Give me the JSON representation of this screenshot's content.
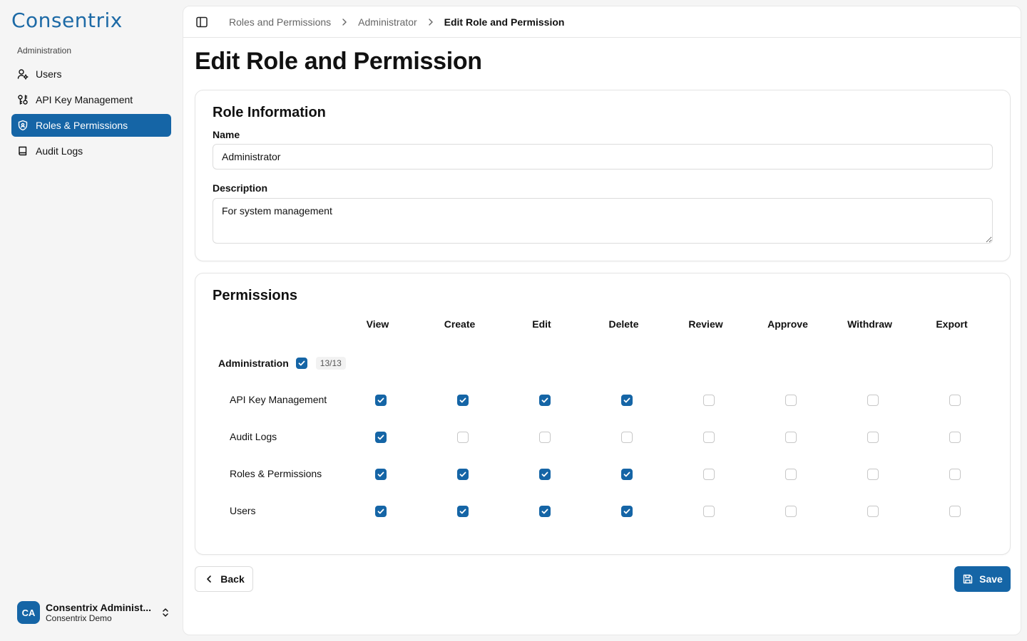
{
  "brand": {
    "logo_text": "Consentrix",
    "accent": "#1565a6"
  },
  "sidebar": {
    "section_label": "Administration",
    "items": [
      {
        "label": "Users",
        "icon": "user-cog-icon",
        "active": false
      },
      {
        "label": "API Key Management",
        "icon": "key-icon",
        "active": false
      },
      {
        "label": "Roles & Permissions",
        "icon": "shield-icon",
        "active": true
      },
      {
        "label": "Audit Logs",
        "icon": "book-icon",
        "active": false
      }
    ],
    "user": {
      "initials": "CA",
      "name": "Consentrix Administ...",
      "org": "Consentrix Demo"
    }
  },
  "breadcrumb": [
    "Roles and Permissions",
    "Administrator",
    "Edit Role and Permission"
  ],
  "page_title": "Edit Role and Permission",
  "role_info": {
    "title": "Role Information",
    "name_label": "Name",
    "name_value": "Administrator",
    "description_label": "Description",
    "description_value": "For system management"
  },
  "permissions": {
    "title": "Permissions",
    "columns": [
      "View",
      "Create",
      "Edit",
      "Delete",
      "Review",
      "Approve",
      "Withdraw",
      "Export"
    ],
    "group": {
      "label": "Administration",
      "checked": true,
      "count": "13/13"
    },
    "rows": [
      {
        "label": "API Key Management",
        "values": [
          true,
          true,
          true,
          true,
          false,
          false,
          false,
          false
        ]
      },
      {
        "label": "Audit Logs",
        "values": [
          true,
          false,
          false,
          false,
          false,
          false,
          false,
          false
        ]
      },
      {
        "label": "Roles & Permissions",
        "values": [
          true,
          true,
          true,
          true,
          false,
          false,
          false,
          false
        ]
      },
      {
        "label": "Users",
        "values": [
          true,
          true,
          true,
          true,
          false,
          false,
          false,
          false
        ]
      }
    ]
  },
  "actions": {
    "back_label": "Back",
    "save_label": "Save"
  }
}
